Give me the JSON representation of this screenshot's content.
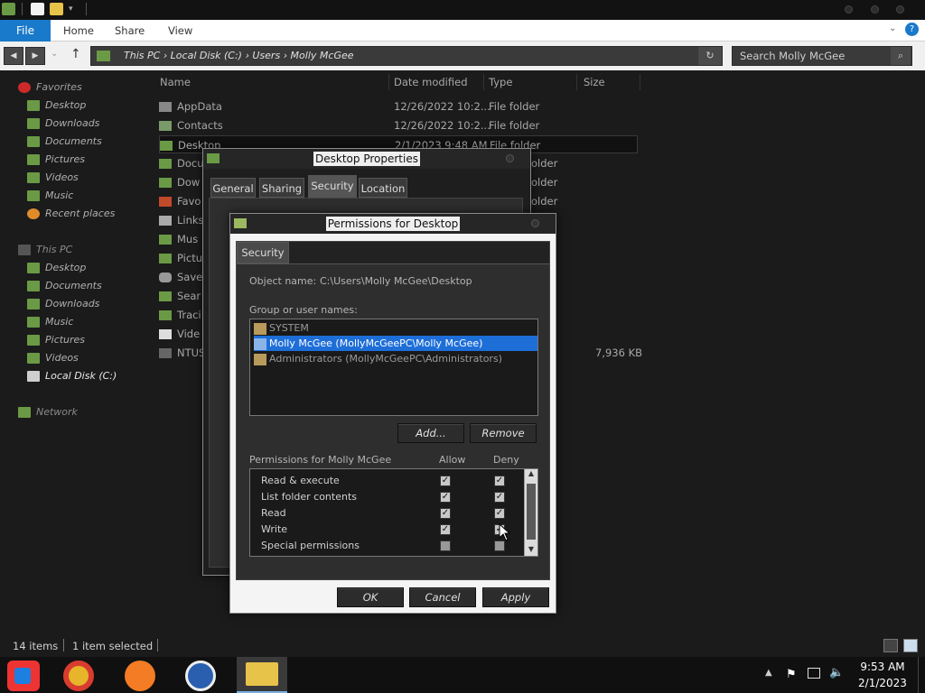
{
  "ribbon": {
    "file": "File",
    "tabs": [
      "Home",
      "Share",
      "View"
    ]
  },
  "address": {
    "crumbs": "This PC  ›  Local Disk (C:)  ›  Users  ›  Molly McGee"
  },
  "search": {
    "placeholder": "Search Molly McGee"
  },
  "sidebar": {
    "favorites_header": "Favorites",
    "favorites": [
      "Desktop",
      "Downloads",
      "Documents",
      "Pictures",
      "Videos",
      "Music",
      "Recent places"
    ],
    "thispc_header": "This PC",
    "thispc": [
      "Desktop",
      "Documents",
      "Downloads",
      "Music",
      "Pictures",
      "Videos",
      "Local Disk (C:)"
    ],
    "network": "Network"
  },
  "columns": {
    "name": "Name",
    "date": "Date modified",
    "type": "Type",
    "size": "Size"
  },
  "files": [
    {
      "name": "AppData",
      "date": "12/26/2022 10:2...",
      "type": "File folder",
      "size": ""
    },
    {
      "name": "Contacts",
      "date": "12/26/2022 10:2...",
      "type": "File folder",
      "size": ""
    },
    {
      "name": "Desktop",
      "date": "2/1/2023 9:48 AM",
      "type": "File folder",
      "size": ""
    },
    {
      "name": "Docu",
      "date": "",
      "type": "older",
      "size": ""
    },
    {
      "name": "Dow",
      "date": "",
      "type": "older",
      "size": ""
    },
    {
      "name": "Favo",
      "date": "",
      "type": "older",
      "size": ""
    },
    {
      "name": "Links",
      "date": "",
      "type": "",
      "size": ""
    },
    {
      "name": "Mus",
      "date": "",
      "type": "",
      "size": ""
    },
    {
      "name": "Pictu",
      "date": "",
      "type": "",
      "size": ""
    },
    {
      "name": "Save",
      "date": "",
      "type": "",
      "size": ""
    },
    {
      "name": "Sear",
      "date": "",
      "type": "",
      "size": ""
    },
    {
      "name": "Traci",
      "date": "",
      "type": "",
      "size": ""
    },
    {
      "name": "Vide",
      "date": "",
      "type": "",
      "size": ""
    },
    {
      "name": "NTUS",
      "date": "",
      "type": "",
      "size": "7,936 KB"
    }
  ],
  "status": {
    "items": "14 items",
    "selected": "1 item selected"
  },
  "props_dialog": {
    "title": "Desktop Properties",
    "tabs": [
      "General",
      "Sharing",
      "Security",
      "Location"
    ]
  },
  "perm_dialog": {
    "title": "Permissions for Desktop",
    "tab": "Security",
    "object_label": "Object name:",
    "object_value": "C:\\Users\\Molly McGee\\Desktop",
    "group_label": "Group or user names:",
    "users": [
      "SYSTEM",
      "Molly McGee (MollyMcGeePC\\Molly McGee)",
      "Administrators (MollyMcGeePC\\Administrators)"
    ],
    "add": "Add...",
    "remove": "Remove",
    "perms_label": "Permissions for Molly McGee",
    "allow": "Allow",
    "deny": "Deny",
    "permissions": [
      {
        "name": "Read & execute",
        "allow": true,
        "deny": true
      },
      {
        "name": "List folder contents",
        "allow": true,
        "deny": true
      },
      {
        "name": "Read",
        "allow": true,
        "deny": true
      },
      {
        "name": "Write",
        "allow": true,
        "deny": true
      },
      {
        "name": "Special permissions",
        "allow": false,
        "deny": false
      }
    ],
    "ok": "OK",
    "cancel": "Cancel",
    "apply": "Apply"
  },
  "clock": {
    "time": "9:53 AM",
    "date": "2/1/2023"
  }
}
